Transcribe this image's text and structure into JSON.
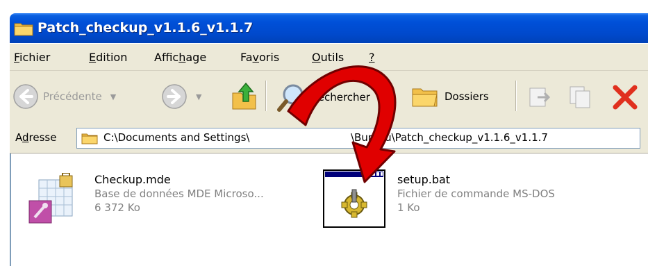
{
  "window": {
    "title": "Patch_checkup_v1.1.6_v1.1.7"
  },
  "menu": [
    {
      "pre": "",
      "u": "F",
      "post": "ichier"
    },
    {
      "pre": "",
      "u": "E",
      "post": "dition"
    },
    {
      "pre": "Affic",
      "u": "h",
      "post": "age"
    },
    {
      "pre": "Fa",
      "u": "v",
      "post": "oris"
    },
    {
      "pre": "",
      "u": "O",
      "post": "utils"
    },
    {
      "pre": "",
      "u": "?",
      "post": ""
    }
  ],
  "toolbar": {
    "back_label": "Précédente",
    "search_label": "Rechercher",
    "folders_label": "Dossiers"
  },
  "address": {
    "label": "Adresse",
    "path_part1": "C:\\Documents and Settings\\",
    "path_part2": "\\Bureau\\Patch_checkup_v1.1.6_v1.1.7"
  },
  "files": [
    {
      "name": "Checkup.mde",
      "description": "Base de données MDE Microso...",
      "size": "6 372 Ko",
      "icon": "access-mde-icon"
    },
    {
      "name": "setup.bat",
      "description": "Fichier de commande MS-DOS",
      "size": "1 Ko",
      "icon": "batch-file-icon"
    }
  ],
  "colors": {
    "titlebar": "#0050d8",
    "chrome": "#ece9d8",
    "annotation_arrow": "#e00000"
  }
}
